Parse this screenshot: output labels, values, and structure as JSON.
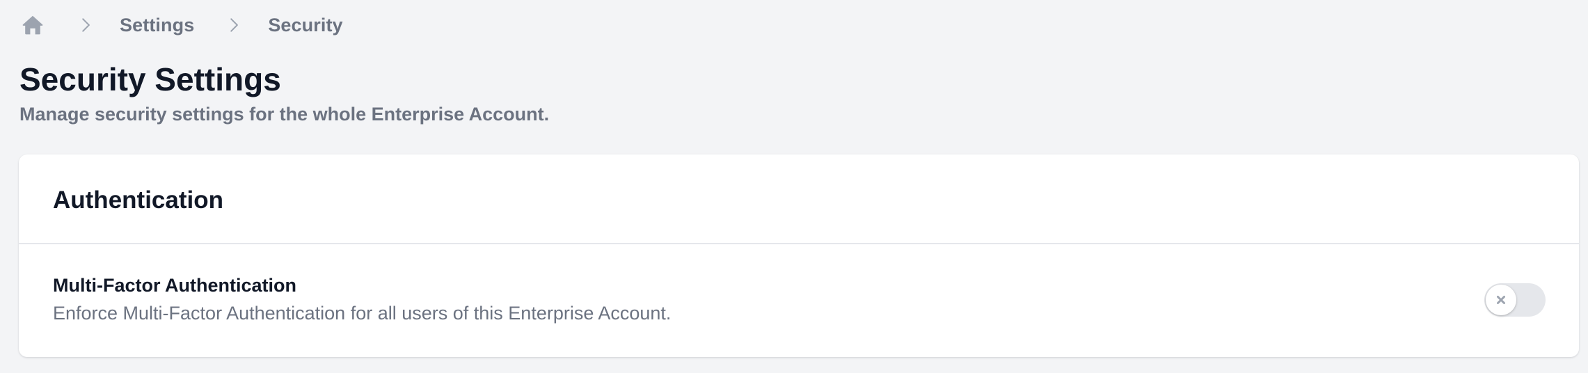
{
  "breadcrumb": {
    "home_icon": "home-icon",
    "separator_icon": "chevron-right-icon",
    "items": [
      {
        "label": "Settings"
      },
      {
        "label": "Security"
      }
    ]
  },
  "header": {
    "title": "Security Settings",
    "subtitle": "Manage security settings for the whole Enterprise Account."
  },
  "card": {
    "title": "Authentication",
    "settings": [
      {
        "title": "Multi-Factor Authentication",
        "description": "Enforce Multi-Factor Authentication for all users of this Enterprise Account.",
        "enabled": false,
        "toggle_icon": "x-icon"
      }
    ]
  },
  "colors": {
    "background": "#f3f4f6",
    "card": "#ffffff",
    "text_primary": "#111827",
    "text_muted": "#6b7280",
    "divider": "#e5e7eb",
    "toggle_off": "#e5e7eb",
    "icon_gray": "#9ca3af"
  }
}
